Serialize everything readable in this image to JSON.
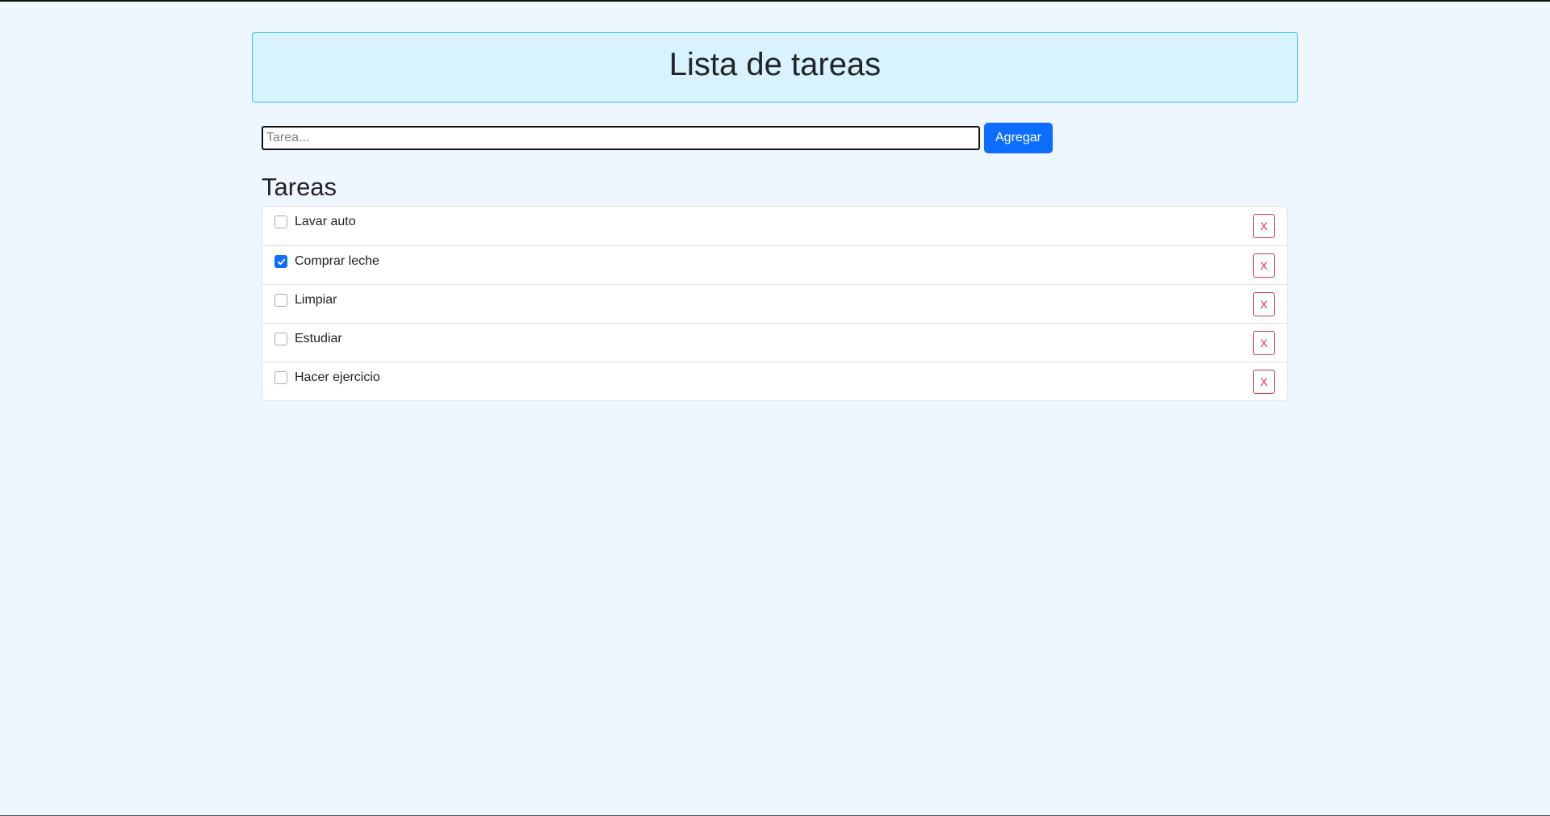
{
  "header": {
    "title": "Lista de tareas"
  },
  "form": {
    "placeholder": "Tarea...",
    "value": "",
    "add_label": "Agregar"
  },
  "section": {
    "title": "Tareas"
  },
  "tasks": [
    {
      "label": "Lavar auto",
      "checked": false,
      "delete_label": "X"
    },
    {
      "label": "Comprar leche",
      "checked": true,
      "delete_label": "X"
    },
    {
      "label": "Limpiar",
      "checked": false,
      "delete_label": "X"
    },
    {
      "label": "Estudiar",
      "checked": false,
      "delete_label": "X"
    },
    {
      "label": "Hacer ejercicio",
      "checked": false,
      "delete_label": "X"
    }
  ],
  "colors": {
    "page_bg": "#eef7ff",
    "header_bg": "#d8f3fd",
    "header_border": "#2bc6e6",
    "primary": "#0d6efd",
    "danger": "#dc3545"
  },
  "icons": {
    "checkmark": "check-icon"
  }
}
